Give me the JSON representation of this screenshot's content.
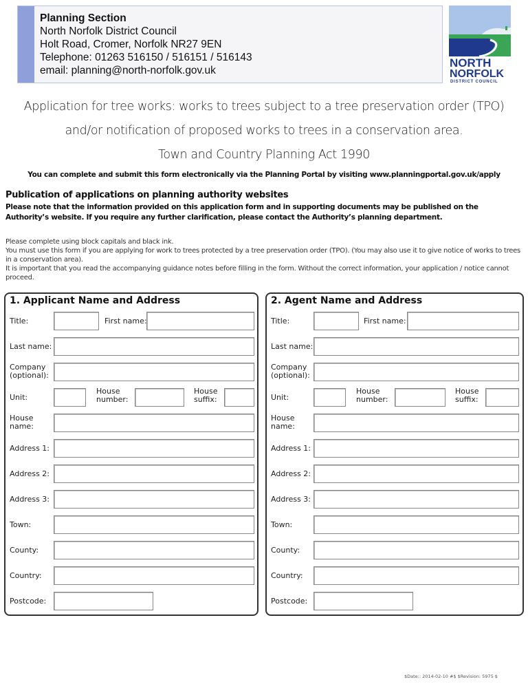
{
  "header": {
    "contact": {
      "section": "Planning Section",
      "council": "North Norfolk District Council",
      "address": "Holt Road, Cromer, Norfolk  NR27 9EN",
      "telephone": "Telephone: 01263  516150 / 516151 / 516143",
      "email": "email:  planning@north-norfolk.gov.uk"
    },
    "logo": {
      "line1": "NORTH",
      "line2": "NORFOLK",
      "line3": "DISTRICT COUNCIL",
      "colors": {
        "sky": "#a9c4e8",
        "sea": "#1f3a8c",
        "land": "#3aa655",
        "text": "#1f3a8c"
      }
    }
  },
  "titles": {
    "line1": "Application for tree works: works to trees subject to a tree preservation order (TPO)",
    "line2": "and/or notification of proposed works to trees in a conservation area.",
    "line3": "Town and Country Planning Act 1990",
    "portal": "You can complete and submit this form electronically via the Planning Portal by visiting www.planningportal.gov.uk/apply"
  },
  "publication": {
    "heading": "Publication of applications on planning authority websites",
    "note": "Please note that the information provided on this application form and in supporting documents may be published on the Authority’s website. If you require any further clarification, please contact the Authority’s planning department."
  },
  "instructions": [
    "Please complete using block capitals and black ink.",
    "You must use this form if you are applying for work to trees protected by a tree preservation order (TPO). (You may also use it to give notice of works to trees in a conservation area).",
    "It is important that you read the accompanying guidance notes before filling in the form. Without the correct information, your application / notice cannot proceed."
  ],
  "applicant": {
    "heading": "1.  Applicant Name and Address",
    "labels": {
      "title": "Title:",
      "first_name": "First name:",
      "last_name": "Last name:",
      "company": "Company (optional):",
      "unit": "Unit:",
      "house_number": "House number:",
      "house_suffix": "House suffix:",
      "house_name": "House name:",
      "address1": "Address 1:",
      "address2": "Address 2:",
      "address3": "Address 3:",
      "town": "Town:",
      "county": "County:",
      "country": "Country:",
      "postcode": "Postcode:"
    },
    "values": {
      "title": "",
      "first_name": "",
      "last_name": "",
      "company": "",
      "unit": "",
      "house_number": "",
      "house_suffix": "",
      "house_name": "",
      "address1": "",
      "address2": "",
      "address3": "",
      "town": "",
      "county": "",
      "country": "",
      "postcode": ""
    }
  },
  "agent": {
    "heading": "2.  Agent Name and Address",
    "labels": {
      "title": "Title:",
      "first_name": "First name:",
      "last_name": "Last name:",
      "company": "Company (optional):",
      "unit": "Unit:",
      "house_number": "House number:",
      "house_suffix": "House suffix:",
      "house_name": "House name:",
      "address1": "Address 1:",
      "address2": "Address 2:",
      "address3": "Address 3:",
      "town": "Town:",
      "county": "County:",
      "country": "Country:",
      "postcode": "Postcode:"
    },
    "values": {
      "title": "",
      "first_name": "",
      "last_name": "",
      "company": "",
      "unit": "",
      "house_number": "",
      "house_suffix": "",
      "house_name": "",
      "address1": "",
      "address2": "",
      "address3": "",
      "town": "",
      "county": "",
      "country": "",
      "postcode": ""
    }
  },
  "footer": {
    "revision": "$Date:: 2014-02-10 #$ $Revision: 5975 $"
  }
}
